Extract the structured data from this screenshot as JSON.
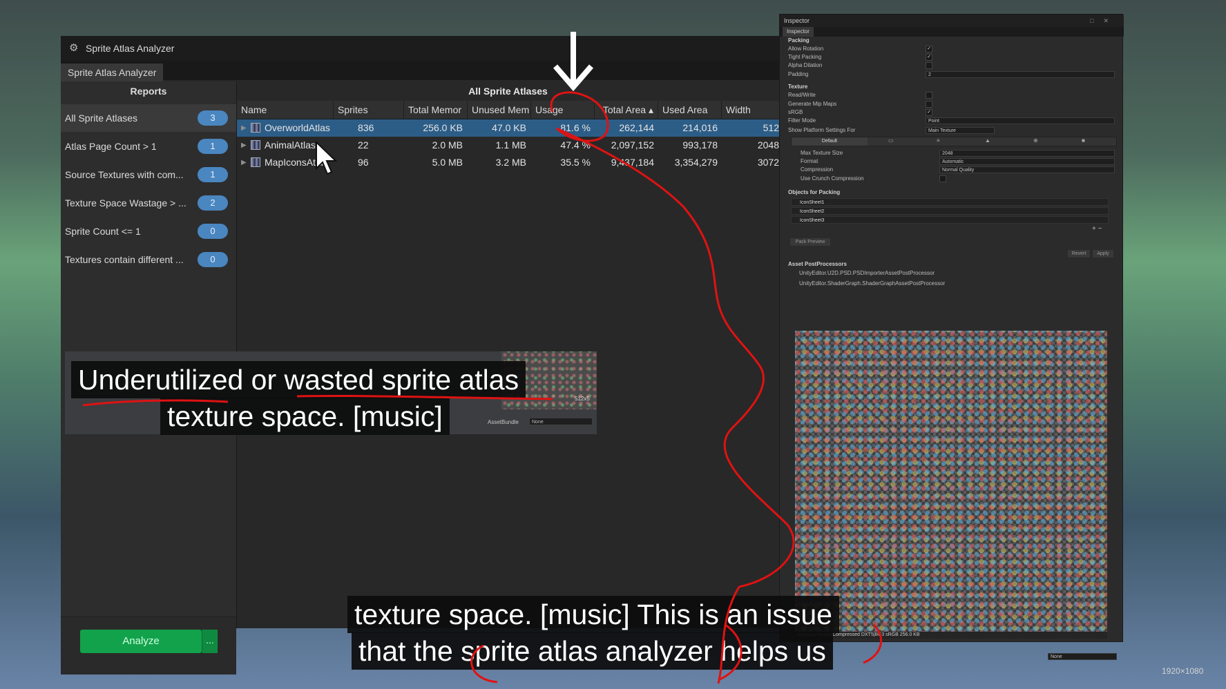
{
  "analyzer": {
    "window_title": "Sprite Atlas Analyzer",
    "tab_label": "Sprite Atlas Analyzer",
    "sidebar": {
      "header": "Reports",
      "items": [
        {
          "label": "All Sprite Atlases",
          "count": "3",
          "selected": true
        },
        {
          "label": "Atlas Page Count > 1",
          "count": "1"
        },
        {
          "label": "Source Textures with com...",
          "count": "1"
        },
        {
          "label": "Texture Space Wastage > ...",
          "count": "2"
        },
        {
          "label": "Sprite Count <= 1",
          "count": "0"
        },
        {
          "label": "Textures contain different ...",
          "count": "0"
        }
      ],
      "analyze_label": "Analyze",
      "analyze_menu_label": "..."
    },
    "main": {
      "title": "All Sprite Atlases",
      "columns": [
        "Name",
        "Sprites",
        "Total Memor",
        "Unused Mem",
        "Usage",
        "Total Area ▴",
        "Used Area",
        "Width"
      ],
      "rows": [
        {
          "name": "OverworldAtlas",
          "sprites": "836",
          "total_memory": "256.0 KB",
          "unused_memory": "47.0 KB",
          "usage": "81.6 %",
          "total_area": "262,144",
          "used_area": "214,016",
          "width": "512",
          "selected": true
        },
        {
          "name": "AnimalAtlas",
          "sprites": "22",
          "total_memory": "2.0 MB",
          "unused_memory": "1.1 MB",
          "usage": "47.4 %",
          "total_area": "2,097,152",
          "used_area": "993,178",
          "width": "2048"
        },
        {
          "name": "MapIconsAtlas",
          "sprites": "96",
          "total_memory": "5.0 MB",
          "unused_memory": "3.2 MB",
          "usage": "35.5 %",
          "total_area": "9,437,184",
          "used_area": "3,354,279",
          "width": "3072"
        }
      ]
    }
  },
  "inspector": {
    "window_title": "Inspector",
    "tab_label": "Inspector",
    "packing_header": "Packing",
    "packing": [
      {
        "label": "Allow Rotation",
        "checked": true
      },
      {
        "label": "Tight Packing",
        "checked": true
      },
      {
        "label": "Alpha Dilation",
        "checked": false
      }
    ],
    "padding_label": "Padding",
    "padding_value": "2",
    "texture_header": "Texture",
    "texture": [
      {
        "label": "Read/Write",
        "checked": false
      },
      {
        "label": "Generate Mip Maps",
        "checked": false
      },
      {
        "label": "sRGB",
        "checked": true
      }
    ],
    "filter_mode_label": "Filter Mode",
    "filter_mode_value": "Point",
    "platform_label": "Show Platform Settings For",
    "platform_value": "Main Texture",
    "platform_tab_default": "Default",
    "max_size_label": "Max Texture Size",
    "max_size_value": "2048",
    "format_label": "Format",
    "format_value": "Automatic",
    "compression_label": "Compression",
    "compression_value": "Normal Quality",
    "crunch_label": "Use Crunch Compression",
    "objects_header": "Objects for Packing",
    "objects": [
      "IconSheet1",
      "IconSheet2",
      "IconSheet3"
    ],
    "add_remove": "+ −",
    "pack_preview": "Pack Preview",
    "revert": "Revert",
    "apply": "Apply",
    "postprocessors_header": "Asset PostProcessors",
    "postprocessors": [
      "UnityEditor.U2D.PSD.PSDImporterAssetPostProcessor",
      "UnityEditor.ShaderGraph.ShaderGraphAssetPostProcessor"
    ],
    "preview_info": "512x512 RGBA Compressed DXT5|BC3 sRGB  256.0 KB",
    "bottom_value": "None"
  },
  "overlay": {
    "thumb_label": "AssetBundle",
    "thumb_value": "None",
    "thumb_size": "512x5",
    "caption_upper": [
      "Underutilized or wasted sprite atlas",
      "texture space. [music]"
    ],
    "caption_lower": [
      "texture space. [music] This is an issue",
      "that the sprite atlas analyzer helps us"
    ],
    "resolution": "1920×1080"
  },
  "colors": {
    "selection": "#2c5d87",
    "badge": "#4a86c0",
    "analyze": "#12a24c",
    "ink": "#e01212"
  },
  "icons": [
    "analyzer-window-icon",
    "atlas-icon",
    "expand-arrow-icon",
    "cursor-icon",
    "down-arrow-icon"
  ]
}
